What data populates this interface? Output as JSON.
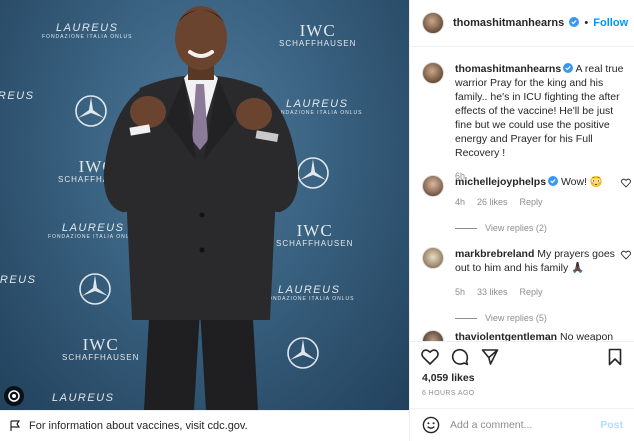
{
  "post": {
    "image_alt_icons": [
      "instagram-glyph-icon"
    ],
    "vaccine_notice": "For information about vaccines, visit cdc.gov.",
    "wall": {
      "iwc_text": "IWC",
      "iwc_sub": "SCHAFFHAUSEN",
      "laureus_text": "LAUREUS",
      "laureus_sub": "FONDAZIONE ITALIA ONLUS"
    }
  },
  "header": {
    "username": "thomashitmanhearns",
    "separator": "•",
    "follow_label": "Follow"
  },
  "caption": {
    "username": "thomashitmanhearns",
    "text": "A real true warrior Pray for the king and his family.. he's in ICU fighting the after effects of the vaccine! He'll be just fine but we could use the positive energy and Prayer for his Full Recovery !",
    "time": "6h"
  },
  "comments": [
    {
      "username": "michellejoyphelps",
      "text": "Wow! 😳",
      "time": "4h",
      "likes": "26 likes",
      "reply": "Reply",
      "view_replies": "View replies (2)"
    },
    {
      "username": "markbrebreland",
      "text": "My prayers goes out to him and his family 🙏🏿",
      "time": "5h",
      "likes": "33 likes",
      "reply": "Reply",
      "view_replies": "View replies (5)"
    },
    {
      "username": "thaviolentgentleman",
      "text": "No weapon",
      "time": "",
      "likes": "",
      "reply": "",
      "view_replies": ""
    }
  ],
  "actions": {
    "likes": "4,059 likes",
    "timestamp": "6 HOURS AGO"
  },
  "add_comment": {
    "placeholder": "Add a comment...",
    "post_label": "Post"
  },
  "colors": {
    "accent": "#0095f6",
    "verified": "#3897f0",
    "post_disabled": "#b2dffc"
  }
}
